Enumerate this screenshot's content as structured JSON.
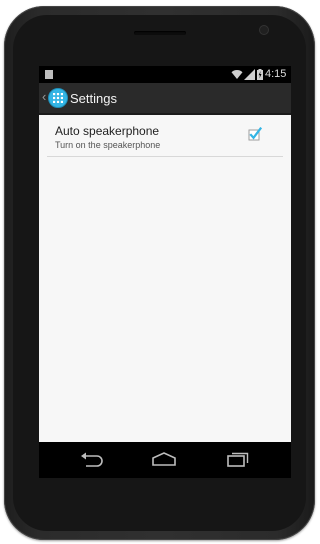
{
  "status_bar": {
    "time": "4:15"
  },
  "action_bar": {
    "title": "Settings",
    "icon": "app-grid-icon"
  },
  "preferences": [
    {
      "title": "Auto speakerphone",
      "summary": "Turn on the speakerphone",
      "checked": true
    }
  ],
  "nav_bar": {
    "buttons": [
      "back-icon",
      "home-icon",
      "recents-icon"
    ]
  },
  "colors": {
    "accent": "#33b5e5",
    "action_bar": "#2a2a2a",
    "content_bg": "#f7f7f7"
  }
}
